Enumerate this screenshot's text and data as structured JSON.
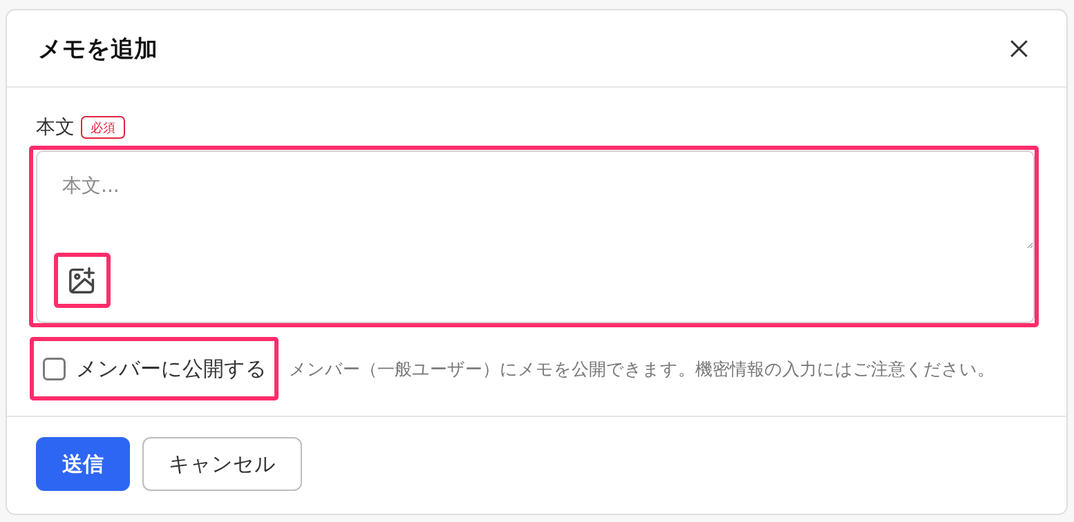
{
  "dialog": {
    "title": "メモを追加"
  },
  "body_field": {
    "label": "本文",
    "required_badge": "必須",
    "placeholder": "本文...",
    "highlighted": true
  },
  "image_button": {
    "highlighted": true
  },
  "public_option": {
    "label": "メンバーに公開する",
    "checked": false,
    "highlighted": true,
    "hint": "メンバー（一般ユーザー）にメモを公開できます。機密情報の入力にはご注意ください。"
  },
  "buttons": [
    {
      "label": "送信",
      "kind": "primary"
    },
    {
      "label": "キャンセル",
      "kind": "secondary"
    }
  ]
}
